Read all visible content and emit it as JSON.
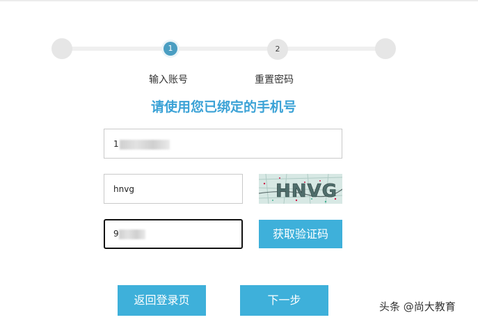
{
  "stepper": {
    "steps": [
      {
        "number": "",
        "label": ""
      },
      {
        "number": "1",
        "label": "输入账号",
        "active": true
      },
      {
        "number": "2",
        "label": "重置密码"
      },
      {
        "number": "",
        "label": ""
      }
    ],
    "active_color": "#4a9ec2"
  },
  "heading": "请使用您已绑定的手机号",
  "form": {
    "phone_value": "1",
    "captcha_value": "hnvg",
    "captcha_image_text": "HNVG",
    "sms_code_value": "9",
    "get_code_label": "获取验证码"
  },
  "actions": {
    "back_label": "返回登录页",
    "next_label": "下一步"
  },
  "watermark": "头条 @尚大教育",
  "colors": {
    "button": "#3eb0da",
    "heading": "#3ba2d6"
  }
}
